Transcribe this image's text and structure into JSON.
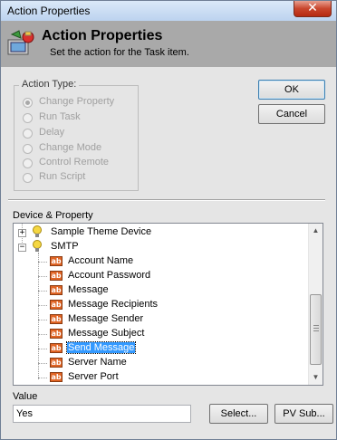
{
  "window": {
    "title": "Action Properties",
    "close_symbol": "✕"
  },
  "header": {
    "title": "Action Properties",
    "subtitle": "Set the action for the Task item.",
    "icon": "action-properties-icon"
  },
  "action_type": {
    "label": "Action Type:",
    "options": [
      {
        "label": "Change Property",
        "checked": true,
        "enabled": false
      },
      {
        "label": "Run Task",
        "checked": false,
        "enabled": false
      },
      {
        "label": "Delay",
        "checked": false,
        "enabled": false
      },
      {
        "label": "Change Mode",
        "checked": false,
        "enabled": false
      },
      {
        "label": "Control Remote",
        "checked": false,
        "enabled": false
      },
      {
        "label": "Run Script",
        "checked": false,
        "enabled": false
      }
    ]
  },
  "buttons": {
    "ok": "OK",
    "cancel": "Cancel",
    "select": "Select...",
    "pv_sub": "PV Sub..."
  },
  "device_property": {
    "label": "Device & Property",
    "tree": [
      {
        "label": "Sample Theme Device",
        "type": "device",
        "expander": "+"
      },
      {
        "label": "SMTP",
        "type": "device",
        "expander": "−"
      },
      {
        "label": "Account Name",
        "type": "property"
      },
      {
        "label": "Account Password",
        "type": "property"
      },
      {
        "label": "Message",
        "type": "property"
      },
      {
        "label": "Message Recipients",
        "type": "property"
      },
      {
        "label": "Message Sender",
        "type": "property"
      },
      {
        "label": "Message Subject",
        "type": "property"
      },
      {
        "label": "Send Message",
        "type": "property",
        "selected": true
      },
      {
        "label": "Server Name",
        "type": "property"
      },
      {
        "label": "Server Port",
        "type": "property"
      }
    ],
    "property_icon_text": "ab"
  },
  "value": {
    "label": "Value",
    "current": "Yes"
  },
  "scrollbar": {
    "up_arrow": "▲",
    "down_arrow": "▼"
  }
}
